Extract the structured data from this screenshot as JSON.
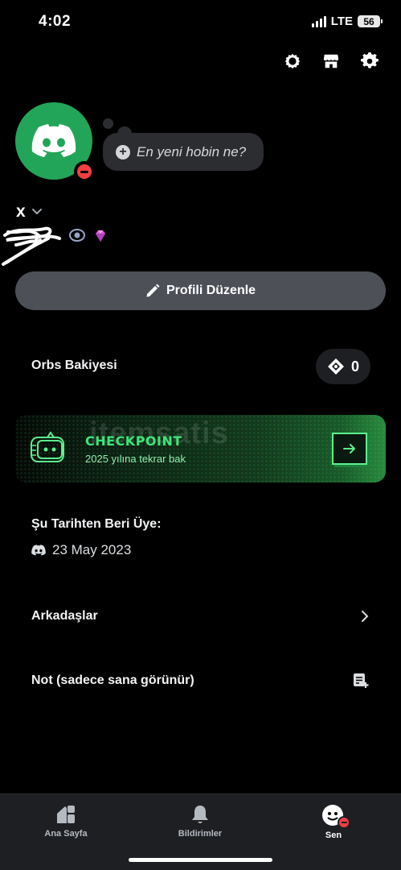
{
  "status_bar": {
    "time": "4:02",
    "network": "LTE",
    "battery": "56"
  },
  "top_icons": [
    "nitro-icon",
    "shop-icon",
    "gear-icon"
  ],
  "profile": {
    "status_placeholder": "En yeni hobin ne?",
    "username": "x",
    "edit_button": "Profili Düzenle",
    "presence": "dnd",
    "avatar_color": "#23a559"
  },
  "orbs": {
    "label": "Orbs Bakiyesi",
    "value": "0"
  },
  "checkpoint": {
    "title": "CHECKPOINT",
    "subtitle": "2025 yılına tekrar bak",
    "watermark": "itemsatis"
  },
  "member_since": {
    "label": "Şu Tarihten Beri Üye:",
    "date": "23 May 2023"
  },
  "rows": {
    "friends": "Arkadaşlar",
    "note": "Not (sadece sana görünür)"
  },
  "tabs": [
    {
      "label": "Ana Sayfa",
      "icon": "home-icon",
      "active": false
    },
    {
      "label": "Bildirimler",
      "icon": "bell-icon",
      "active": false
    },
    {
      "label": "Sen",
      "icon": "avatar-icon",
      "active": true
    }
  ],
  "colors": {
    "accent_green": "#23a559",
    "dnd_red": "#f23f43",
    "checkpoint_green": "#3de57a"
  }
}
